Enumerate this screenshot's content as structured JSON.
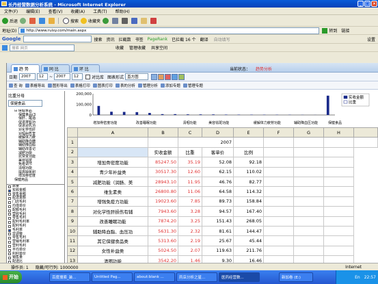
{
  "window": {
    "title": "长丹经营数据分析系统 - Microsoft Internet Explorer"
  },
  "menubar": [
    "文件(F)",
    "编辑(E)",
    "查看(V)",
    "收藏(A)",
    "工具(T)",
    "帮助(H)"
  ],
  "toolbar": {
    "back": "后退",
    "search": "搜索",
    "favorites": "收藏夹"
  },
  "addressbar": {
    "label": "地址(D)",
    "url": "http://www.ruisy.com/main.aspx",
    "go": "转到",
    "links": "链接"
  },
  "googlebar": {
    "search": "搜索",
    "news": "资讯",
    "blocked": "拦截数",
    "bookmarks": "书签",
    "pagerank": "PageRank",
    "checked": "已拦截 16 个",
    "translate": "翻译",
    "spell": "自动填写",
    "settings": "设置"
  },
  "searchbar": {
    "placeholder": "搜索 网页",
    "favorites": "收藏",
    "mgmt": "管理收藏",
    "share": "共享空间"
  },
  "app": {
    "tabs": [
      "趋 势",
      "同 比",
      "环 比"
    ],
    "state_label": "当前状态：",
    "state_value": "趋势分析",
    "filter": {
      "date_label": "日期",
      "y1": "2007",
      "m1": "12",
      "y2": "2007",
      "m2": "12",
      "compare": "对比库",
      "chart_label": "图表形式",
      "chart_value": "直方图"
    },
    "actions": [
      "查 询",
      "表格导出",
      "图形导出",
      "表格打印",
      "图表打印",
      "表的分析",
      "管理分析",
      "添加专题",
      "管理专题"
    ]
  },
  "leftpanel": {
    "title": "比重分母",
    "select": "保健食品",
    "tree": [
      "保健食品",
      "保健食品(3",
      "保肝、醒酒",
      "促进排铅功",
      "促进泌乳功",
      "对化学性肝",
      "对辐射危害",
      "缓解体力疲",
      "辅助降血糖",
      "辅助降血脂",
      "辅助改善记",
      "减肥功能",
      "抗突变功能",
      "美容祛斑",
      "免疫调节",
      "清咽功能",
      "提高缺氧耐",
      "增加骨密度",
      "保健用品"
    ],
    "lower": [
      "数量",
      "实收金额",
      "零售金额",
      "配送金额",
      "门店毛利",
      "均值单价",
      "配额毛利",
      "营收毛利",
      "零售毛利",
      "配利毛利率",
      "配利毛利",
      "毛利率",
      "非调整",
      "零售毛利",
      "营销毛利率",
      "营利毛利",
      "平均单价",
      "利利单价",
      "销售量",
      "配送比"
    ]
  },
  "chart_data": {
    "type": "bar",
    "ylim": [
      0,
      200000
    ],
    "yticks": [
      "200,000",
      "100,000",
      "0"
    ],
    "category_labels": [
      "增加骨密度功能",
      "改善睡眠功能",
      "清咽功能",
      "美容祛斑功能",
      "缓解体力疲劳功能",
      "辅助降血压功能",
      "保健食品"
    ],
    "series": [
      {
        "name": "实收金额",
        "values": [
          85247.5,
          30517.3,
          28943.1,
          26800.8,
          19023.6,
          7943.6,
          7874.2,
          5631.3,
          5313.6,
          5024.5,
          3542.2,
          3208.0,
          2800,
          2500,
          2200,
          1800,
          1200,
          800,
          182000
        ]
      },
      {
        "name": "比重",
        "values": [
          35.19,
          12.6,
          11.95,
          11.06,
          7.85,
          3.28,
          3.25,
          2.32,
          2.19,
          2.07,
          1.46,
          1.32,
          1.15,
          1.03,
          0.91,
          0.74,
          0.5,
          0.33,
          100
        ]
      }
    ],
    "legend": [
      "实收金额",
      "比重"
    ]
  },
  "grid": {
    "col_headers": [
      "A",
      "B",
      "C",
      "D",
      "E",
      "F",
      "G",
      "H"
    ],
    "year": "2007",
    "sub_headers": [
      "实收金额",
      "比重",
      "客单价",
      "比例"
    ],
    "rows": [
      {
        "n": "3",
        "name": "增加骨密度功能",
        "amt": "85247.50",
        "pct": "35.19",
        "price": "52.08",
        "ratio": "92.18"
      },
      {
        "n": "4",
        "name": "青少年补益类",
        "amt": "30517.30",
        "pct": "12.60",
        "price": "62.15",
        "ratio": "110.02"
      },
      {
        "n": "5",
        "name": "减肥功能（润肠、美",
        "amt": "28943.10",
        "pct": "11.95",
        "price": "46.76",
        "ratio": "82.77"
      },
      {
        "n": "6",
        "name": "维生素类",
        "amt": "26800.80",
        "pct": "11.06",
        "price": "64.58",
        "ratio": "114.32"
      },
      {
        "n": "7",
        "name": "增强免疫力功能",
        "amt": "19023.60",
        "pct": "7.85",
        "price": "89.73",
        "ratio": "158.84"
      },
      {
        "n": "8",
        "name": "对化学性肝损伤有辅",
        "amt": "7943.60",
        "pct": "3.28",
        "price": "94.57",
        "ratio": "167.40"
      },
      {
        "n": "9",
        "name": "改善睡眠功能",
        "amt": "7874.20",
        "pct": "3.25",
        "price": "151.43",
        "ratio": "268.05"
      },
      {
        "n": "10",
        "name": "辅助降血脂、血压功",
        "amt": "5631.30",
        "pct": "2.32",
        "price": "81.61",
        "ratio": "144.47"
      },
      {
        "n": "11",
        "name": "其它保健食品类",
        "amt": "5313.60",
        "pct": "2.19",
        "price": "25.67",
        "ratio": "45.44"
      },
      {
        "n": "12",
        "name": "女性补益类",
        "amt": "5024.50",
        "pct": "2.07",
        "price": "119.63",
        "ratio": "211.76"
      },
      {
        "n": "13",
        "name": "清咽功能",
        "amt": "3542.20",
        "pct": "1.46",
        "price": "9.30",
        "ratio": "16.46"
      },
      {
        "n": "14",
        "name": "保肝、醒酒类",
        "amt": "3208.00",
        "pct": "1.32",
        "price": "21.82",
        "ratio": "38.63"
      }
    ]
  },
  "statusbar": {
    "status": "操作员: 1",
    "records": "隐藏/可行列: 1000000",
    "zone": "Internet"
  },
  "taskbar": {
    "start": "开始",
    "tasks": [
      "百度搜索_装...",
      "Untitled Pag...",
      "about:blank ...",
      "药店分析之星...",
      "医药经营数...",
      "新加卷 (E:)"
    ],
    "lang": "En",
    "time": "22:57"
  }
}
